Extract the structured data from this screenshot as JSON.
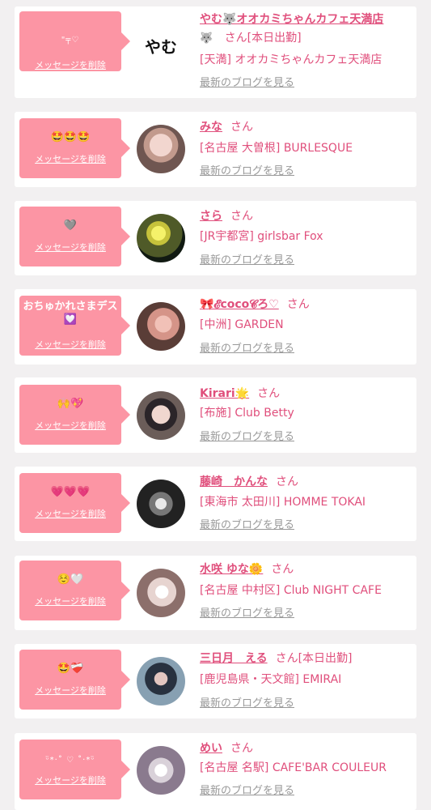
{
  "ui": {
    "delete_label": "メッセージを削除",
    "blog_label": "最新のブログを見る",
    "san": "さん"
  },
  "colors": {
    "accent_pink": "#e04f7c",
    "bubble_pink": "#fc95a4",
    "muted_link": "#999999",
    "page_bg": "#f2f0f1"
  },
  "entries": [
    {
      "message": "\"╤♡",
      "name": "やむ🐺オオカミちゃんカフェ天満店",
      "name_suffix_icon": "🐺",
      "status": "[本日出勤]",
      "shop": "[天満] オオカミちゃんカフェ天満店",
      "avatar_text": "やむ",
      "avatar_icon": "text-logo"
    },
    {
      "message": "🤩🤩🤩",
      "name": "みな",
      "status": "",
      "shop": "[名古屋 大曽根] BURLESQUE",
      "avatar_icon": "avatar-photo"
    },
    {
      "message": "🩶",
      "name": "さら",
      "status": "",
      "shop": "[JR宇都宮] girlsbar Fox",
      "avatar_icon": "avatar-photo"
    },
    {
      "message": "おちゅかれさまデス💟",
      "name": "🎀𝓔coco𝓒ろ♡",
      "status": "",
      "shop": "[中洲] GARDEN",
      "avatar_icon": "avatar-photo"
    },
    {
      "message": "🙌💖",
      "name": "Kirari🌟",
      "status": "",
      "shop": "[布施] Club Betty",
      "avatar_icon": "avatar-photo"
    },
    {
      "message": "💗💗💗",
      "name": "藤崎　かんな",
      "status": "",
      "shop": "[東海市 太田川] HOMME TOKAI",
      "avatar_icon": "avatar-photo"
    },
    {
      "message": "☺️🤍",
      "name": "水咲 ゆな🌼",
      "status": "",
      "shop": "[名古屋 中村区] Club NIGHT CAFE",
      "avatar_icon": "avatar-photo"
    },
    {
      "message": "🤩❤️‍🩹",
      "name": "三日月　える",
      "status": "[本日出勤]",
      "shop": "[鹿児島県・天文館] EMIRAI",
      "avatar_icon": "avatar-photo"
    },
    {
      "message": "ᵕ̈*·˚ ♡ ˚·*ᵕ̈",
      "name": "めい",
      "status": "",
      "shop": "[名古屋 名駅] CAFE'BAR COULEUR",
      "avatar_icon": "avatar-photo"
    }
  ]
}
